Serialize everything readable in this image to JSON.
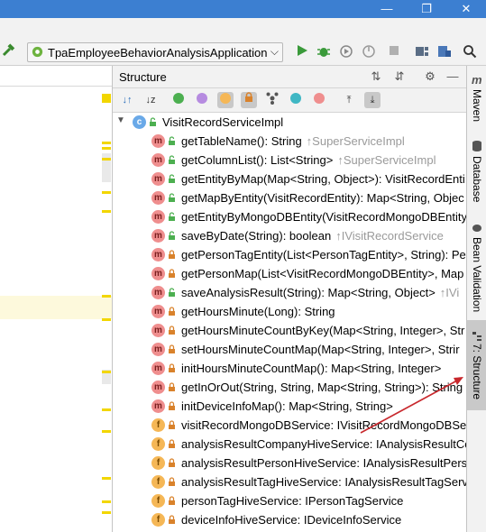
{
  "window": {
    "restore_glyph": "❐",
    "close_glyph": "✕"
  },
  "toolbar": {
    "run_config": "TpaEmployeeBehaviorAnalysisApplication",
    "icons": [
      "hammer-icon",
      "run-icon",
      "debug-icon",
      "coverage-icon",
      "profile-icon",
      "stop-icon",
      "project-structure-icon",
      "sdk-icon",
      "search-icon"
    ]
  },
  "structure": {
    "title": "Structure",
    "class_name": "VisitRecordServiceImpl",
    "items": [
      {
        "kind": "m",
        "name": "getTableName(): String",
        "inherited": "↑SuperServiceImpl",
        "access": "public"
      },
      {
        "kind": "m",
        "name": "getColumnList(): List<String>",
        "inherited": "↑SuperServiceImpl",
        "access": "public"
      },
      {
        "kind": "m",
        "name": "getEntityByMap(Map<String, Object>): VisitRecordEnti",
        "inherited": "",
        "access": "public"
      },
      {
        "kind": "m",
        "name": "getMapByEntity(VisitRecordEntity): Map<String, Objec",
        "inherited": "",
        "access": "public"
      },
      {
        "kind": "m",
        "name": "getEntityByMongoDBEntity(VisitRecordMongoDBEntity",
        "inherited": "",
        "access": "public"
      },
      {
        "kind": "m",
        "name": "saveByDate(String): boolean",
        "inherited": "↑IVisitRecordService",
        "access": "public"
      },
      {
        "kind": "m",
        "name": "getPersonTagEntity(List<PersonTagEntity>, String): Per",
        "inherited": "",
        "access": "private"
      },
      {
        "kind": "m",
        "name": "getPersonMap(List<VisitRecordMongoDBEntity>, Map",
        "inherited": "",
        "access": "private"
      },
      {
        "kind": "m",
        "name": "saveAnalysisResult(String): Map<String, Object>",
        "inherited": "↑IVi",
        "access": "public"
      },
      {
        "kind": "m",
        "name": "getHoursMinute(Long): String",
        "inherited": "",
        "access": "private"
      },
      {
        "kind": "m",
        "name": "getHoursMinuteCountByKey(Map<String, Integer>, Str",
        "inherited": "",
        "access": "private"
      },
      {
        "kind": "m",
        "name": "setHoursMinuteCountMap(Map<String, Integer>, Strir",
        "inherited": "",
        "access": "private"
      },
      {
        "kind": "m",
        "name": "initHoursMinuteCountMap(): Map<String, Integer>",
        "inherited": "",
        "access": "private"
      },
      {
        "kind": "m",
        "name": "getInOrOut(String, String, Map<String, String>): String",
        "inherited": "",
        "access": "private"
      },
      {
        "kind": "m",
        "name": "initDeviceInfoMap(): Map<String, String>",
        "inherited": "",
        "access": "private"
      },
      {
        "kind": "f",
        "name": "visitRecordMongoDBService: IVisitRecordMongoDBSe",
        "inherited": "",
        "access": "private"
      },
      {
        "kind": "f",
        "name": "analysisResultCompanyHiveService: IAnalysisResultCon",
        "inherited": "",
        "access": "private"
      },
      {
        "kind": "f",
        "name": "analysisResultPersonHiveService: IAnalysisResultPersor",
        "inherited": "",
        "access": "private"
      },
      {
        "kind": "f",
        "name": "analysisResultTagHiveService: IAnalysisResultTagServic",
        "inherited": "",
        "access": "private"
      },
      {
        "kind": "f",
        "name": "personTagHiveService: IPersonTagService",
        "inherited": "",
        "access": "private"
      },
      {
        "kind": "f",
        "name": "deviceInfoHiveService: IDeviceInfoService",
        "inherited": "",
        "access": "private"
      }
    ]
  },
  "right_tabs": [
    {
      "label": "Maven",
      "icon": "m"
    },
    {
      "label": "Database",
      "icon": "database-icon"
    },
    {
      "label": "Bean Validation",
      "icon": "bean-icon"
    },
    {
      "label": "7: Structure",
      "icon": "structure-icon"
    }
  ],
  "colors": {
    "accent": "#3c7fd1",
    "annotation_arrow": "#c8282d",
    "method_badge": "#ef8e8e",
    "field_badge": "#f5b756"
  }
}
